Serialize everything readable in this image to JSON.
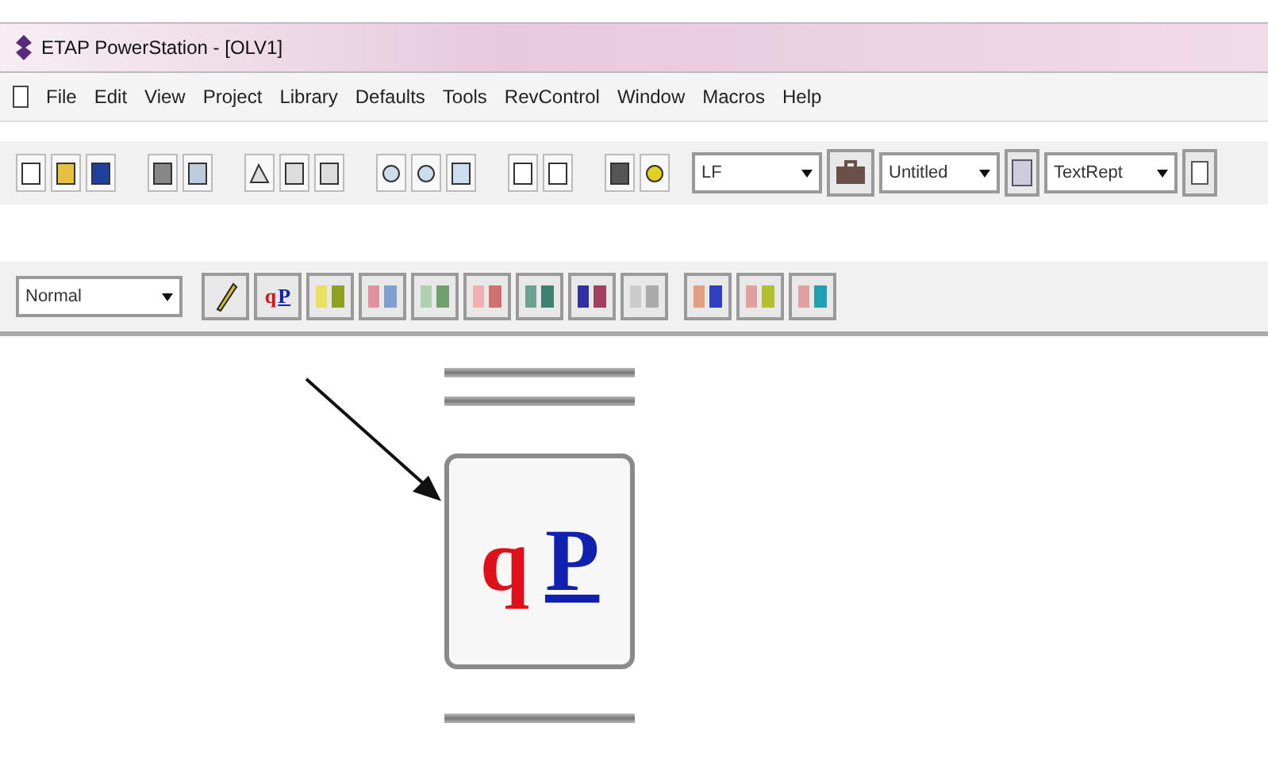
{
  "window": {
    "title": "ETAP PowerStation - [OLV1]"
  },
  "menu": [
    "File",
    "Edit",
    "View",
    "Project",
    "Library",
    "Defaults",
    "Tools",
    "RevControl",
    "Window",
    "Macros",
    "Help"
  ],
  "toolbar": {
    "study_select": "LF",
    "case_select": "Untitled",
    "report_select": "TextRept"
  },
  "mode_toolbar": {
    "mode_select": "Normal",
    "load_flow_button": {
      "left_letter": "q",
      "right_letter": "P"
    }
  },
  "callout": {
    "left_letter": "q",
    "right_letter": "P"
  }
}
